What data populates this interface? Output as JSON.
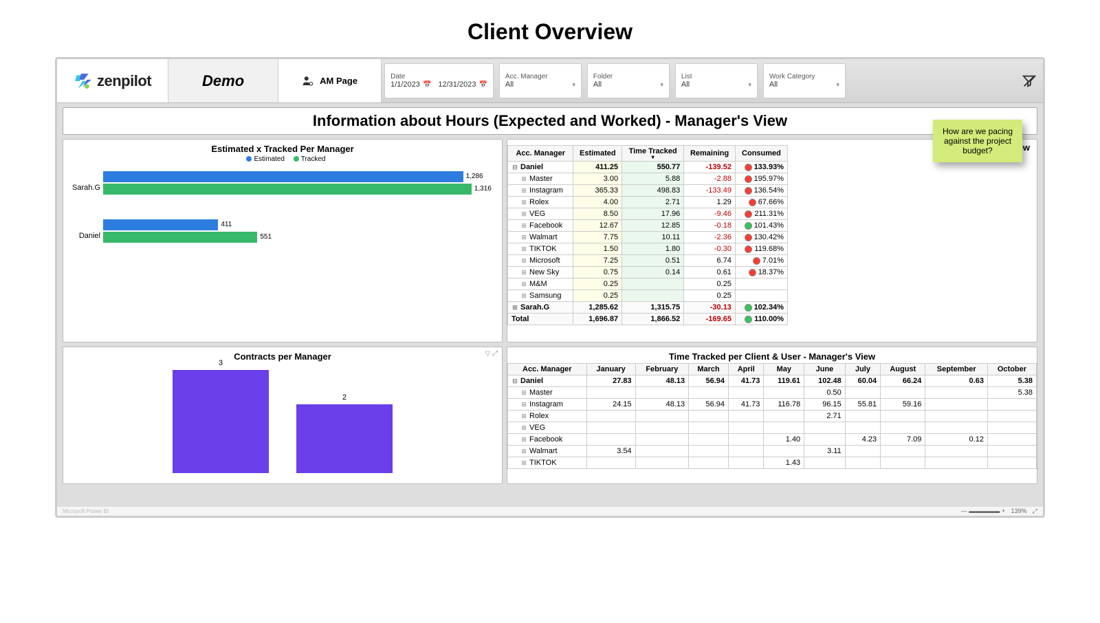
{
  "page_title": "Client Overview",
  "brand": "zenpilot",
  "demo_label": "Demo",
  "tab": {
    "label": "AM Page"
  },
  "filters": {
    "date": {
      "label": "Date",
      "from": "1/1/2023",
      "to": "12/31/2023"
    },
    "manager": {
      "label": "Acc. Manager",
      "value": "All"
    },
    "folder": {
      "label": "Folder",
      "value": "All"
    },
    "list": {
      "label": "List",
      "value": "All"
    },
    "category": {
      "label": "Work Category",
      "value": "All"
    }
  },
  "banner": "Information about Hours (Expected and Worked) - Manager's View",
  "sticky_note": "How are we pacing against the project budget?",
  "chart_data": [
    {
      "id": "est_tracked_per_manager",
      "type": "bar",
      "orientation": "horizontal",
      "title": "Estimated x Tracked Per Manager",
      "legend": [
        "Estimated",
        "Tracked"
      ],
      "categories": [
        "Sarah.G",
        "Daniel"
      ],
      "series": [
        {
          "name": "Estimated",
          "values": [
            1286,
            411
          ]
        },
        {
          "name": "Tracked",
          "values": [
            1316,
            551
          ]
        }
      ],
      "max": 1400
    },
    {
      "id": "contracts_per_manager",
      "type": "bar",
      "title": "Contracts per Manager",
      "categories": [
        "",
        ""
      ],
      "values": [
        3,
        2
      ],
      "ylim": [
        0,
        3
      ]
    }
  ],
  "time_overview": {
    "title": "Time Overview",
    "columns": [
      "Acc. Manager",
      "Estimated",
      "Time Tracked",
      "Remaining",
      "Consumed"
    ],
    "rows": [
      {
        "t": "parent",
        "exp": "⊟",
        "name": "Daniel",
        "est": "411.25",
        "trk": "550.77",
        "rem": "-139.52",
        "cons": "133.93%",
        "dot": "red"
      },
      {
        "t": "child",
        "name": "Master",
        "est": "3.00",
        "trk": "5.88",
        "rem": "-2.88",
        "cons": "195.97%",
        "dot": "red"
      },
      {
        "t": "child",
        "name": "Instagram",
        "est": "365.33",
        "trk": "498.83",
        "rem": "-133.49",
        "cons": "136.54%",
        "dot": "red"
      },
      {
        "t": "child",
        "name": "Rolex",
        "est": "4.00",
        "trk": "2.71",
        "rem": "1.29",
        "cons": "67.66%",
        "dot": "red"
      },
      {
        "t": "child",
        "name": "VEG",
        "est": "8.50",
        "trk": "17.96",
        "rem": "-9.46",
        "cons": "211.31%",
        "dot": "red"
      },
      {
        "t": "child",
        "name": "Facebook",
        "est": "12.67",
        "trk": "12.85",
        "rem": "-0.18",
        "cons": "101.43%",
        "dot": "green"
      },
      {
        "t": "child",
        "name": "Walmart",
        "est": "7.75",
        "trk": "10.11",
        "rem": "-2.36",
        "cons": "130.42%",
        "dot": "red"
      },
      {
        "t": "child",
        "name": "TIKTOK",
        "est": "1.50",
        "trk": "1.80",
        "rem": "-0.30",
        "cons": "119.68%",
        "dot": "red"
      },
      {
        "t": "child",
        "name": "Microsoft",
        "est": "7.25",
        "trk": "0.51",
        "rem": "6.74",
        "cons": "7.01%",
        "dot": "red"
      },
      {
        "t": "child",
        "name": "New Sky",
        "est": "0.75",
        "trk": "0.14",
        "rem": "0.61",
        "cons": "18.37%",
        "dot": "red"
      },
      {
        "t": "child",
        "name": "M&M",
        "est": "0.25",
        "trk": "",
        "rem": "0.25",
        "cons": "",
        "dot": ""
      },
      {
        "t": "child",
        "name": "Samsung",
        "est": "0.25",
        "trk": "",
        "rem": "0.25",
        "cons": "",
        "dot": ""
      }
    ],
    "footer": [
      {
        "exp": "⊞",
        "name": "Sarah.G",
        "est": "1,285.62",
        "trk": "1,315.75",
        "rem": "-30.13",
        "cons": "102.34%",
        "dot": "green"
      },
      {
        "name": "Total",
        "est": "1,696.87",
        "trk": "1,866.52",
        "rem": "-169.65",
        "cons": "110.00%",
        "dot": "green"
      }
    ]
  },
  "monthly": {
    "title": "Time Tracked per Client & User - Manager's View",
    "columns": [
      "Acc. Manager",
      "January",
      "February",
      "March",
      "April",
      "May",
      "June",
      "July",
      "August",
      "September",
      "October"
    ],
    "rows": [
      {
        "t": "parent",
        "exp": "⊟",
        "name": "Daniel",
        "vals": [
          "27.83",
          "48.13",
          "56.94",
          "41.73",
          "119.61",
          "102.48",
          "60.04",
          "66.24",
          "0.63",
          "5.38"
        ]
      },
      {
        "t": "child",
        "name": "Master",
        "vals": [
          "",
          "",
          "",
          "",
          "",
          "0.50",
          "",
          "",
          "",
          "5.38"
        ]
      },
      {
        "t": "child",
        "name": "Instagram",
        "vals": [
          "24.15",
          "48.13",
          "56.94",
          "41.73",
          "116.78",
          "96.15",
          "55.81",
          "59.16",
          "",
          ""
        ]
      },
      {
        "t": "child",
        "name": "Rolex",
        "vals": [
          "",
          "",
          "",
          "",
          "",
          "2.71",
          "",
          "",
          "",
          ""
        ]
      },
      {
        "t": "child",
        "name": "VEG",
        "vals": [
          "",
          "",
          "",
          "",
          "",
          "",
          "",
          "",
          "",
          ""
        ]
      },
      {
        "t": "child",
        "name": "Facebook",
        "vals": [
          "",
          "",
          "",
          "",
          "1.40",
          "",
          "4.23",
          "7.09",
          "0.12",
          ""
        ]
      },
      {
        "t": "child",
        "name": "Walmart",
        "vals": [
          "3.54",
          "",
          "",
          "",
          "",
          "3.11",
          "",
          "",
          "",
          ""
        ]
      },
      {
        "t": "child",
        "name": "TIKTOK",
        "vals": [
          "",
          "",
          "",
          "",
          "1.43",
          "",
          "",
          "",
          "",
          ""
        ]
      }
    ]
  },
  "footer": {
    "zoom": "139%"
  }
}
